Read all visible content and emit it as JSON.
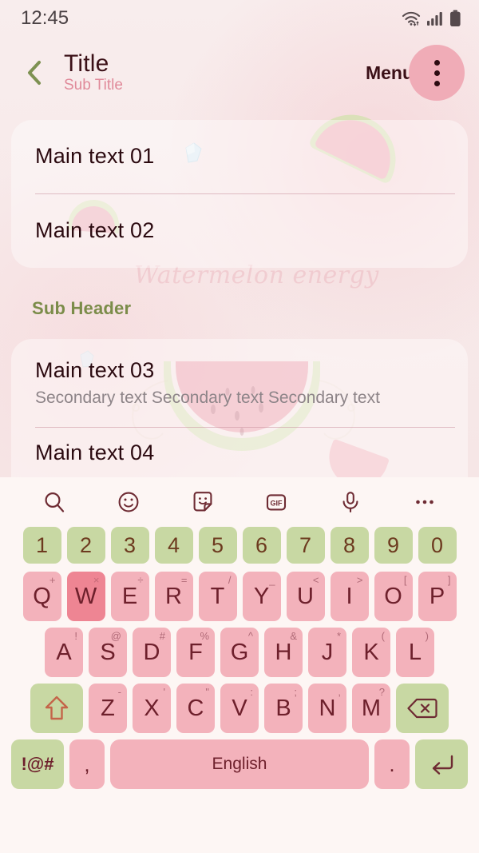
{
  "status_bar": {
    "time": "12:45",
    "icons": [
      "wifi-icon",
      "signal-icon",
      "battery-icon"
    ]
  },
  "app_bar": {
    "back_icon": "chevron-left-icon",
    "title": "Title",
    "subtitle": "Sub Title",
    "menu_label": "Menu",
    "menu_icon": "more-vertical-icon"
  },
  "decorations": {
    "script_watermark": "Watermelon energy"
  },
  "list": {
    "card_one": [
      {
        "main": "Main text 01"
      },
      {
        "main": "Main text 02"
      }
    ],
    "sub_header": "Sub Header",
    "card_two": [
      {
        "main": "Main text 03",
        "secondary": "Secondary text Secondary text Secondary text"
      },
      {
        "main": "Main text 04"
      }
    ]
  },
  "keyboard": {
    "toolbar": [
      {
        "name": "search-icon",
        "label": "search"
      },
      {
        "name": "emoji-icon",
        "label": "emoji"
      },
      {
        "name": "sticker-icon",
        "label": "sticker"
      },
      {
        "name": "gif-icon",
        "label": "GIF"
      },
      {
        "name": "microphone-icon",
        "label": "voice"
      },
      {
        "name": "more-horizontal-icon",
        "label": "more"
      }
    ],
    "gif_label": "GIF",
    "number_row": [
      "1",
      "2",
      "3",
      "4",
      "5",
      "6",
      "7",
      "8",
      "9",
      "0"
    ],
    "row_qwerty": [
      {
        "key": "Q",
        "sup": "+"
      },
      {
        "key": "W",
        "sup": "×",
        "pressed": true
      },
      {
        "key": "E",
        "sup": "÷"
      },
      {
        "key": "R",
        "sup": "="
      },
      {
        "key": "T",
        "sup": "/"
      },
      {
        "key": "Y",
        "sup": "_"
      },
      {
        "key": "U",
        "sup": "<"
      },
      {
        "key": "I",
        "sup": ">"
      },
      {
        "key": "O",
        "sup": "["
      },
      {
        "key": "P",
        "sup": "]"
      }
    ],
    "row_asdf": [
      {
        "key": "A",
        "sup": "!"
      },
      {
        "key": "S",
        "sup": "@"
      },
      {
        "key": "D",
        "sup": "#"
      },
      {
        "key": "F",
        "sup": "%"
      },
      {
        "key": "G",
        "sup": "^"
      },
      {
        "key": "H",
        "sup": "&"
      },
      {
        "key": "J",
        "sup": "*"
      },
      {
        "key": "K",
        "sup": "("
      },
      {
        "key": "L",
        "sup": ")"
      }
    ],
    "row_zxcv": [
      {
        "key": "Z",
        "sup": "-"
      },
      {
        "key": "X",
        "sup": "'"
      },
      {
        "key": "C",
        "sup": "\""
      },
      {
        "key": "V",
        "sup": ":"
      },
      {
        "key": "B",
        "sup": ";"
      },
      {
        "key": "N",
        "sup": ","
      },
      {
        "key": "M",
        "sup": "?"
      }
    ],
    "shift_icon": "shift-arrow-icon",
    "backspace_icon": "backspace-icon",
    "symbols_label": "!@#",
    "comma_label": ",",
    "space_label": "English",
    "period_label": ".",
    "enter_icon": "enter-return-icon"
  },
  "colors": {
    "background": "#f8eded",
    "key_green": "#c8d8a3",
    "key_pink": "#f3b2bb",
    "key_pink_pressed": "#ee8593",
    "accent_title": "#3b1017",
    "accent_subtitle": "#e08a9a",
    "sub_header": "#7b8c49",
    "keyboard_bg": "#fdf6f4"
  }
}
